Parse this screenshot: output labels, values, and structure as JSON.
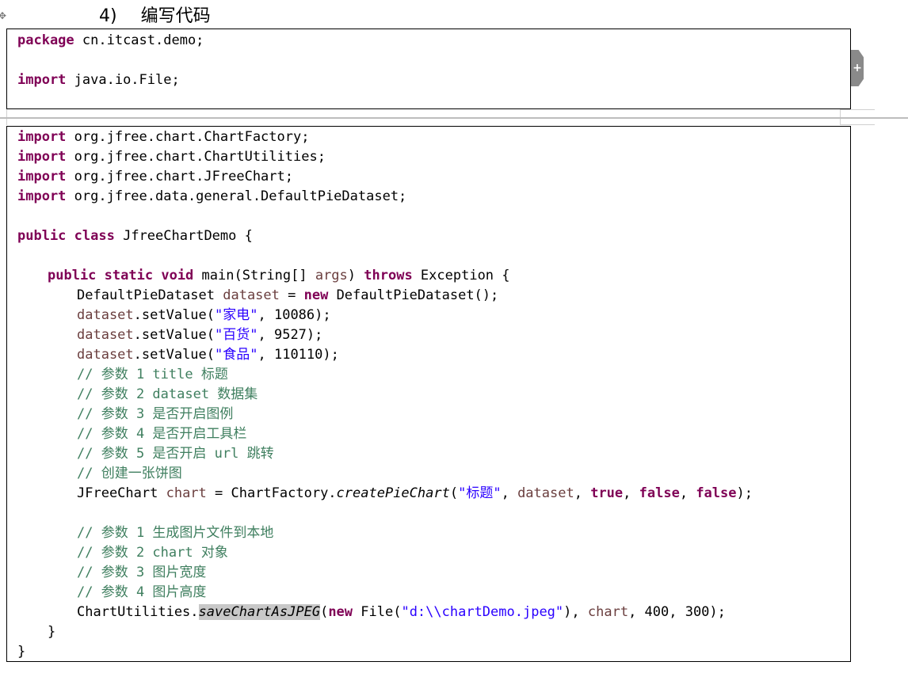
{
  "heading": {
    "number": "4)",
    "title": "编写代码"
  },
  "side_tab": {
    "icon": "plus-icon",
    "glyph": "+"
  },
  "code_block_1": [
    [
      {
        "t": "package",
        "c": "kw"
      },
      {
        "t": " cn.itcast.demo;"
      }
    ],
    [],
    [
      {
        "t": "import",
        "c": "kw"
      },
      {
        "t": " java.io.File;"
      }
    ]
  ],
  "code_block_2": [
    [
      {
        "t": "import",
        "c": "kw"
      },
      {
        "t": " org.jfree.chart.ChartFactory;"
      }
    ],
    [
      {
        "t": "import",
        "c": "kw"
      },
      {
        "t": " org.jfree.chart.ChartUtilities;"
      }
    ],
    [
      {
        "t": "import",
        "c": "kw"
      },
      {
        "t": " org.jfree.chart.JFreeChart;"
      }
    ],
    [
      {
        "t": "import",
        "c": "kw"
      },
      {
        "t": " org.jfree.data.general.DefaultPieDataset;"
      }
    ],
    [],
    [
      {
        "t": "public",
        "c": "kw"
      },
      {
        "t": " "
      },
      {
        "t": "class",
        "c": "kw"
      },
      {
        "t": " JfreeChartDemo {"
      }
    ],
    [],
    [
      {
        "i": 1
      },
      {
        "t": "public",
        "c": "kw"
      },
      {
        "t": " "
      },
      {
        "t": "static",
        "c": "kw"
      },
      {
        "t": " "
      },
      {
        "t": "void",
        "c": "kw"
      },
      {
        "t": " main(String[] "
      },
      {
        "t": "args",
        "c": "var"
      },
      {
        "t": ") "
      },
      {
        "t": "throws",
        "c": "kw"
      },
      {
        "t": " Exception {"
      }
    ],
    [
      {
        "i": 2
      },
      {
        "t": "DefaultPieDataset "
      },
      {
        "t": "dataset",
        "c": "var"
      },
      {
        "t": " = "
      },
      {
        "t": "new",
        "c": "kw"
      },
      {
        "t": " DefaultPieDataset();"
      }
    ],
    [
      {
        "i": 2
      },
      {
        "t": "dataset",
        "c": "var"
      },
      {
        "t": ".setValue("
      },
      {
        "t": "\"家电\"",
        "c": "str"
      },
      {
        "t": ", 10086);"
      }
    ],
    [
      {
        "i": 2
      },
      {
        "t": "dataset",
        "c": "var"
      },
      {
        "t": ".setValue("
      },
      {
        "t": "\"百货\"",
        "c": "str"
      },
      {
        "t": ", 9527);"
      }
    ],
    [
      {
        "i": 2
      },
      {
        "t": "dataset",
        "c": "var"
      },
      {
        "t": ".setValue("
      },
      {
        "t": "\"食品\"",
        "c": "str"
      },
      {
        "t": ", 110110);"
      }
    ],
    [
      {
        "i": 2
      },
      {
        "t": "// 参数 1 title 标题",
        "c": "cmt"
      }
    ],
    [
      {
        "i": 2
      },
      {
        "t": "// 参数 2 dataset 数据集",
        "c": "cmt"
      }
    ],
    [
      {
        "i": 2
      },
      {
        "t": "// 参数 3 是否开启图例",
        "c": "cmt"
      }
    ],
    [
      {
        "i": 2
      },
      {
        "t": "// 参数 4 是否开启工具栏",
        "c": "cmt"
      }
    ],
    [
      {
        "i": 2
      },
      {
        "t": "// 参数 5 是否开启 url 跳转",
        "c": "cmt"
      }
    ],
    [
      {
        "i": 2
      },
      {
        "t": "// 创建一张饼图",
        "c": "cmt"
      }
    ],
    [
      {
        "i": 2
      },
      {
        "t": "JFreeChart "
      },
      {
        "t": "chart",
        "c": "var"
      },
      {
        "t": " = ChartFactory."
      },
      {
        "t": "createPieChart",
        "c": "it"
      },
      {
        "t": "("
      },
      {
        "t": "\"标题\"",
        "c": "str"
      },
      {
        "t": ", "
      },
      {
        "t": "dataset",
        "c": "var"
      },
      {
        "t": ", "
      },
      {
        "t": "true",
        "c": "kw"
      },
      {
        "t": ", "
      },
      {
        "t": "false",
        "c": "kw"
      },
      {
        "t": ", "
      },
      {
        "t": "false",
        "c": "kw"
      },
      {
        "t": ");"
      }
    ],
    [],
    [
      {
        "i": 2
      },
      {
        "t": "// 参数 1 生成图片文件到本地",
        "c": "cmt"
      }
    ],
    [
      {
        "i": 2
      },
      {
        "t": "// 参数 2 chart 对象",
        "c": "cmt"
      }
    ],
    [
      {
        "i": 2
      },
      {
        "t": "// 参数 3 图片宽度",
        "c": "cmt"
      }
    ],
    [
      {
        "i": 2
      },
      {
        "t": "// 参数 4 图片高度",
        "c": "cmt"
      }
    ],
    [
      {
        "i": 2
      },
      {
        "t": "ChartUtilities."
      },
      {
        "t": "saveChartAsJPEG",
        "c": "it hl"
      },
      {
        "t": "("
      },
      {
        "t": "new",
        "c": "kw"
      },
      {
        "t": " File("
      },
      {
        "t": "\"d:\\\\chartDemo.jpeg\"",
        "c": "str"
      },
      {
        "t": "), "
      },
      {
        "t": "chart",
        "c": "var"
      },
      {
        "t": ", 400, 300);"
      }
    ],
    [
      {
        "i": 1
      },
      {
        "t": "}"
      }
    ],
    [
      {
        "t": "}"
      }
    ]
  ],
  "colors": {
    "keyword": "#7f0055",
    "variable": "#6a3e3e",
    "string": "#2a00ff",
    "comment": "#3f7f5f",
    "highlight": "#c8c8c8"
  }
}
